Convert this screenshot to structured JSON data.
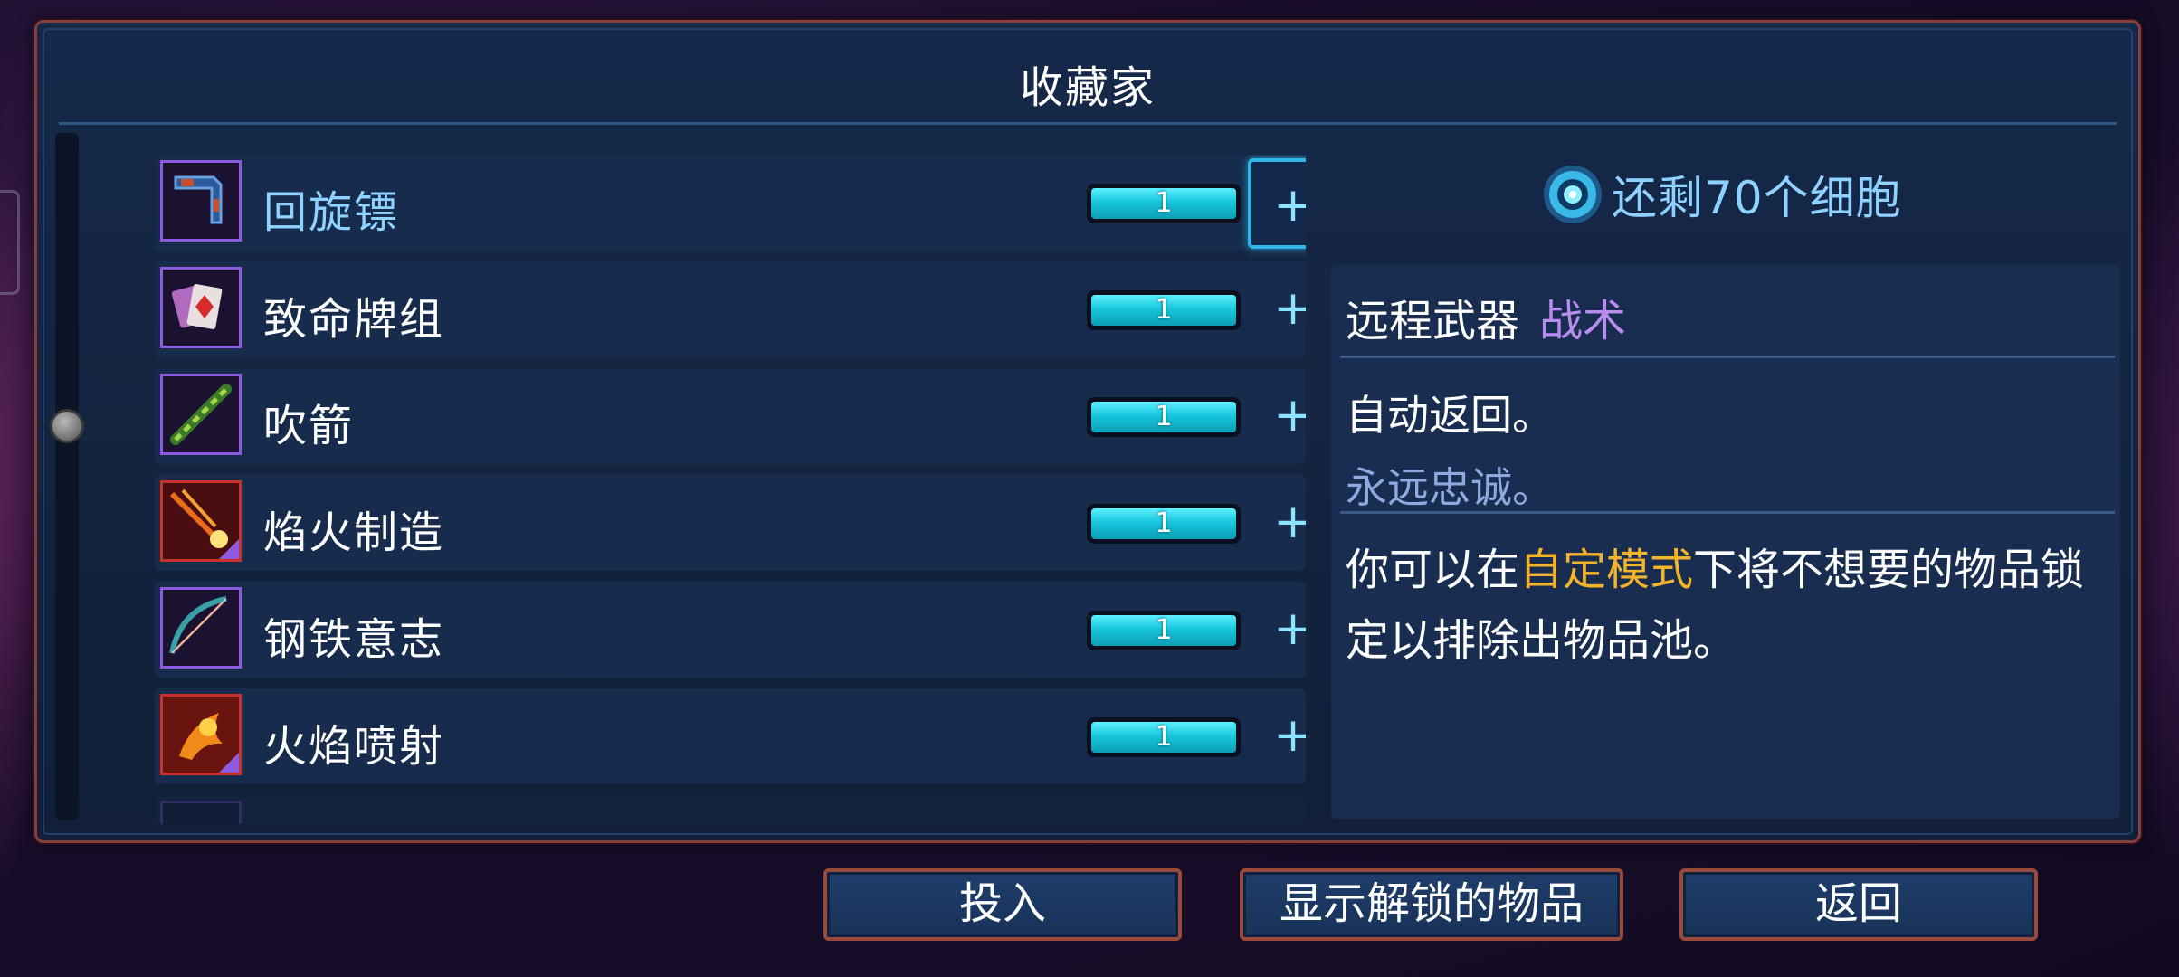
{
  "panel": {
    "title": "收藏家"
  },
  "items": [
    {
      "name": "回旋镖",
      "count": "1",
      "plus": "+",
      "selected": true,
      "icon": "boomerang-icon"
    },
    {
      "name": "致命牌组",
      "count": "1",
      "plus": "+",
      "icon": "card-deck-icon"
    },
    {
      "name": "吹箭",
      "count": "1",
      "plus": "+",
      "icon": "blowgun-icon"
    },
    {
      "name": "焰火制造",
      "count": "1",
      "plus": "+",
      "icon": "firework-icon"
    },
    {
      "name": "钢铁意志",
      "count": "1",
      "plus": "+",
      "icon": "bow-icon"
    },
    {
      "name": "火焰喷射",
      "count": "1",
      "plus": "+",
      "icon": "flamethrower-icon"
    }
  ],
  "cells": {
    "text": "还剩70个细胞",
    "icon": "cell-icon"
  },
  "detail": {
    "category": "远程武器",
    "subcategory": "战术",
    "description": "自动返回。",
    "flavor": "永远忠诚。",
    "tip_prefix": "你可以在",
    "tip_highlight": "自定模式",
    "tip_suffix": "下将不想要的物品锁定以排除出物品池。"
  },
  "buttons": {
    "invest": "投入",
    "show_unlocked": "显示解锁的物品",
    "back": "返回"
  },
  "colors": {
    "accent_cyan": "#16c6dc",
    "selected_name": "#8fd2ff",
    "subcategory_purple": "#b98cf0",
    "highlight_orange": "#f2b42c",
    "frame_copper": "#8a3e3a"
  }
}
